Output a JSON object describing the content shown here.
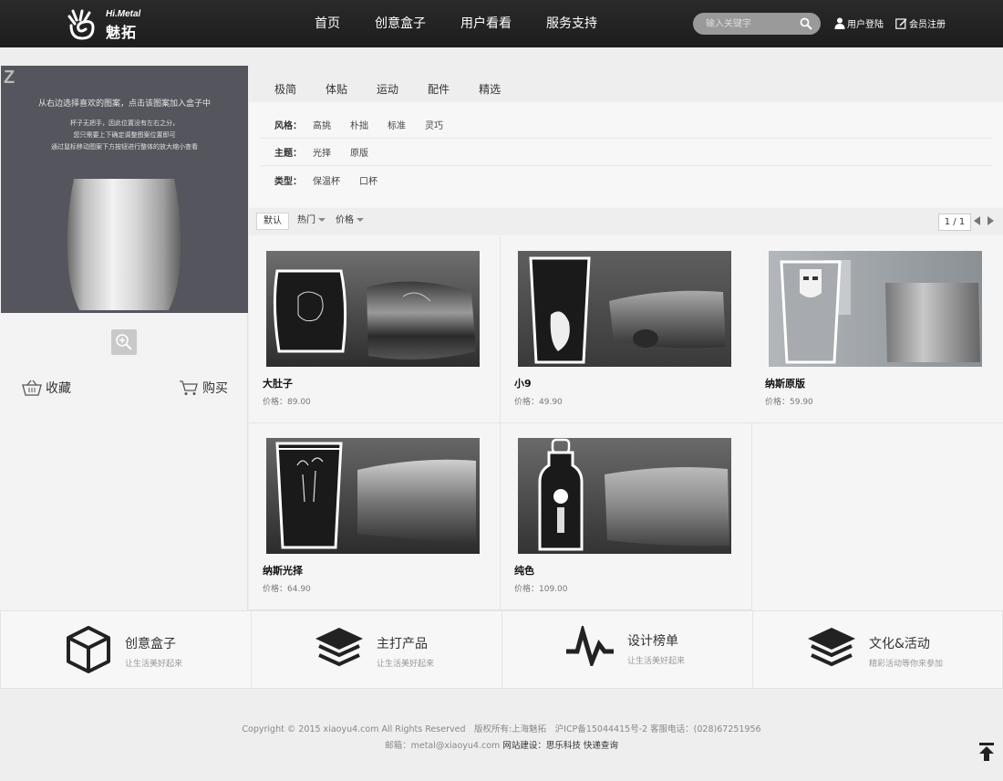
{
  "brand": {
    "logo_en": "Hi.Metal",
    "logo_cn": "魅拓"
  },
  "nav": [
    "首页",
    "创意盒子",
    "用户看看",
    "服务支持"
  ],
  "search": {
    "placeholder": "输入关键字"
  },
  "user": {
    "login": "用户登陆",
    "register": "会员注册"
  },
  "preview": {
    "z": "Z",
    "title": "从右边选择喜欢的图案，点击该图案加入盒子中",
    "line1": "杯子无把手，因此位置没有左右之分，",
    "line2": "您只需要上下确定调整图案位置即可",
    "line3": "通过鼠标移动图案下方按钮进行整体的放大缩小查看"
  },
  "actions": {
    "collect": "收藏",
    "buy": "购买"
  },
  "tabs": [
    "极简",
    "体贴",
    "运动",
    "配件",
    "精选"
  ],
  "filters": [
    {
      "label": "风格：",
      "options": [
        "高挑",
        "朴拙",
        "标准",
        "灵巧"
      ]
    },
    {
      "label": "主题：",
      "options": [
        "光择",
        "原版"
      ]
    },
    {
      "label": "类型：",
      "options": [
        "保温杯",
        "口杯"
      ]
    }
  ],
  "sort": {
    "default": "默认",
    "hot": "热门",
    "price": "价格",
    "pager": "1 / 1"
  },
  "products": [
    {
      "name": "大肚子",
      "price": "价格：89.00"
    },
    {
      "name": "小9",
      "price": "价格：49.90"
    },
    {
      "name": "纳斯原版",
      "price": "价格：59.90"
    },
    {
      "name": "纳斯光择",
      "price": "价格：64.90"
    },
    {
      "name": "纯色",
      "price": "价格：109.00"
    }
  ],
  "features": [
    {
      "title": "创意盒子",
      "sub": "让生活美好起来",
      "icon": "box-icon"
    },
    {
      "title": "主打产品",
      "sub": "让生活美好起来",
      "icon": "layers-icon"
    },
    {
      "title": "设计榜单",
      "sub": "让生活美好起来",
      "icon": "pulse-icon"
    },
    {
      "title": "文化&活动",
      "sub": "精彩活动等你来参加",
      "icon": "layers-icon"
    }
  ],
  "footer": {
    "copyright": "Copyright © 2015 xiaoyu4.com All Rights Reserved　版权所有:上海魅拓　沪ICP备15044415号-2 客服电话：(028)67251956",
    "email": "邮箱：metal@xiaoyu4.com",
    "build_label": "网站建设：",
    "build_name": "思乐科技",
    "express": "快递查询"
  },
  "colors": {
    "header": "#1f1f1f",
    "preview_bg": "#55555d",
    "page_bg": "#eeeeee"
  }
}
